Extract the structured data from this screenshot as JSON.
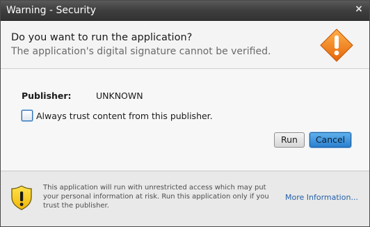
{
  "window": {
    "title": "Warning - Security",
    "close_glyph": "×"
  },
  "header": {
    "question": "Do you want to run the application?",
    "subtext": "The application's digital signature cannot be verified.",
    "icon": "warning-diamond-icon",
    "icon_color": "#ef7d1a"
  },
  "details": {
    "publisher_label": "Publisher:",
    "publisher_value": "UNKNOWN",
    "trust_checkbox_label": "Always trust content from this publisher.",
    "trust_checked": false
  },
  "buttons": {
    "run_label": "Run",
    "cancel_label": "Cancel"
  },
  "footer": {
    "icon": "shield-warning-icon",
    "message": "This application will run with unrestricted access which may put your personal information at risk. Run this application only if you trust the publisher.",
    "more_info_link": "More Information..."
  }
}
